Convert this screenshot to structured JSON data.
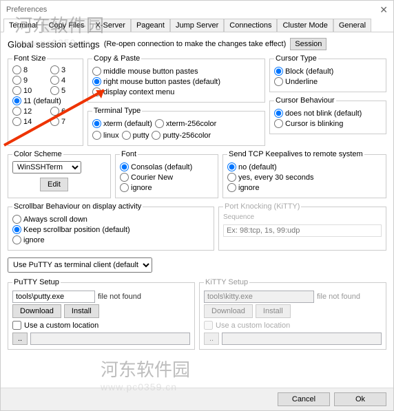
{
  "window": {
    "title": "Preferences"
  },
  "tabs": [
    "Terminal",
    "Copy Files",
    "X-Server",
    "Pageant",
    "Jump Server",
    "Connections",
    "Cluster Mode",
    "General"
  ],
  "sessionbar": {
    "label": "Global session settings",
    "hint": "(Re-open connection to make the changes take effect)",
    "session_btn": "Session"
  },
  "fontsize": {
    "legend": "Font Size",
    "opts": [
      "8",
      "3",
      "9",
      "4",
      "10",
      "5",
      "11 (default)",
      "12",
      "6",
      "14",
      "7"
    ]
  },
  "copypaste": {
    "legend": "Copy & Paste",
    "opts": [
      "middle mouse button pastes",
      "right mouse button pastes (default)",
      "display context menu"
    ]
  },
  "cursortype": {
    "legend": "Cursor Type",
    "opts": [
      "Block (default)",
      "Underline"
    ]
  },
  "terminaltype": {
    "legend": "Terminal Type",
    "opts": [
      "xterm (default)",
      "xterm-256color",
      "linux",
      "putty",
      "putty-256color"
    ]
  },
  "cursorbeh": {
    "legend": "Cursor Behaviour",
    "opts": [
      "does not blink (default)",
      "Cursor is blinking"
    ]
  },
  "colorscheme": {
    "legend": "Color Scheme",
    "value": "WinSSHTerm",
    "edit": "Edit"
  },
  "font": {
    "legend": "Font",
    "opts": [
      "Consolas (default)",
      "Courier New",
      "ignore"
    ]
  },
  "keepalive": {
    "legend": "Send TCP Keepalives to remote system",
    "opts": [
      "no (default)",
      "yes, every 30 seconds",
      "ignore"
    ]
  },
  "scrollbeh": {
    "legend": "Scrollbar Behaviour on display activity",
    "opts": [
      "Always scroll down",
      "Keep scrollbar position (default)",
      "ignore"
    ]
  },
  "portknock": {
    "legend": "Port Knocking (KiTTY)",
    "sub": "Sequence",
    "ph": "Ex: 98:tcp, 1s, 99:udp"
  },
  "term_client": {
    "value": "Use PuTTY as terminal client (default)"
  },
  "putty": {
    "legend": "PuTTY Setup",
    "path": "tools\\putty.exe",
    "notfound": "file not found",
    "download": "Download",
    "install": "Install",
    "custom": "Use a custom location",
    "browse": ".."
  },
  "kitty": {
    "legend": "KiTTY Setup",
    "path": "tools\\kitty.exe",
    "notfound": "file not found",
    "download": "Download",
    "install": "Install",
    "custom": "Use a custom location",
    "browse": ".."
  },
  "buttons": {
    "cancel": "Cancel",
    "ok": "Ok"
  },
  "watermark": {
    "line1": "河东软件园",
    "line2": "www.pc0359.cn"
  }
}
